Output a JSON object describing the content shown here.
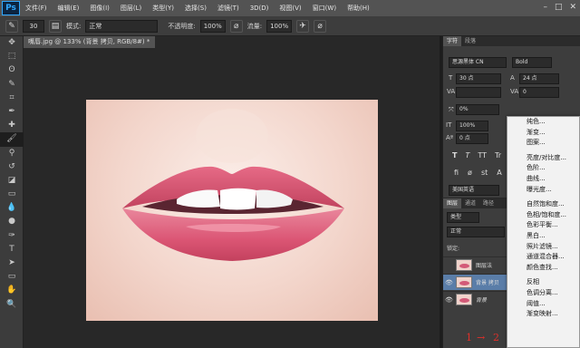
{
  "app": {
    "logo": "Ps"
  },
  "menubar": {
    "items": [
      "文件(F)",
      "编辑(E)",
      "图像(I)",
      "图层(L)",
      "类型(Y)",
      "选择(S)",
      "滤镜(T)",
      "3D(D)",
      "视图(V)",
      "窗口(W)",
      "帮助(H)"
    ],
    "window_controls": [
      "–",
      "□",
      "✕"
    ]
  },
  "options": {
    "brush_size": "30",
    "mode_label": "模式:",
    "mode_value": "正常",
    "opacity_label": "不透明度:",
    "opacity_value": "100%",
    "flow_label": "流量:",
    "flow_value": "100%"
  },
  "document": {
    "tab_title": "嘴唇.jpg @ 133% (背景 拷贝, RGB/8#) *"
  },
  "toolbar": {
    "icons": [
      "move-icon",
      "marquee-icon",
      "lasso-icon",
      "quick-select-icon",
      "crop-icon",
      "eyedropper-icon",
      "healing-icon",
      "brush-icon",
      "stamp-icon",
      "history-brush-icon",
      "eraser-icon",
      "gradient-icon",
      "blur-icon",
      "dodge-icon",
      "pen-icon",
      "type-icon",
      "path-select-icon",
      "shape-icon",
      "hand-icon",
      "zoom-icon"
    ],
    "glyphs": [
      "✥",
      "⬚",
      "ʘ",
      "✎",
      "⌗",
      "✒",
      "✚",
      "🖌",
      "⚲",
      "↺",
      "◪",
      "▭",
      "💧",
      "●",
      "✑",
      "T",
      "➤",
      "▭",
      "✋",
      "🔍"
    ],
    "active_index": 7
  },
  "character_panel": {
    "tabs": [
      "字符",
      "段落"
    ],
    "font_family": "思源黑体 CN",
    "font_style": "Bold",
    "font_size": "30 点",
    "leading": "24 点",
    "tracking": "0",
    "baseline_pct": "0%",
    "vertical_scale": "100%",
    "baseline_shift": "0 点",
    "style_glyphs": [
      "T",
      "T",
      "TT",
      "Tr",
      "T¹"
    ],
    "ligature_glyphs": [
      "fi",
      "ø",
      "st",
      "A"
    ],
    "language": "美国英语"
  },
  "layers_panel": {
    "tabs": [
      "图层",
      "通道",
      "路径"
    ],
    "kind_label": "类型",
    "blend_mode": "正常",
    "lock_label": "锁定:",
    "layers": [
      {
        "name": "图层法",
        "visible": false,
        "selected": false
      },
      {
        "name": "背景 拷贝",
        "visible": true,
        "selected": true
      },
      {
        "name": "背景",
        "visible": true,
        "selected": false
      }
    ]
  },
  "context_menu": {
    "groups": [
      [
        "纯色...",
        "渐变...",
        "图案..."
      ],
      [
        "亮度/对比度...",
        "色阶...",
        "曲线...",
        "曝光度..."
      ],
      [
        "自然饱和度...",
        "色相/饱和度...",
        "色彩平衡...",
        "黑白...",
        "照片滤镜...",
        "通道混合器...",
        "颜色查找..."
      ],
      [
        "反相",
        "色调分离...",
        "阈值...",
        "渐变映射..."
      ]
    ]
  },
  "annotations": {
    "marks": [
      "1",
      "→",
      "2"
    ],
    "color": "#e0302a"
  },
  "colors": {
    "lip": "#d9546f",
    "lip_highlight": "#f5a3b4",
    "skin": "#f3d6cc",
    "selection": "#5a7da8"
  }
}
